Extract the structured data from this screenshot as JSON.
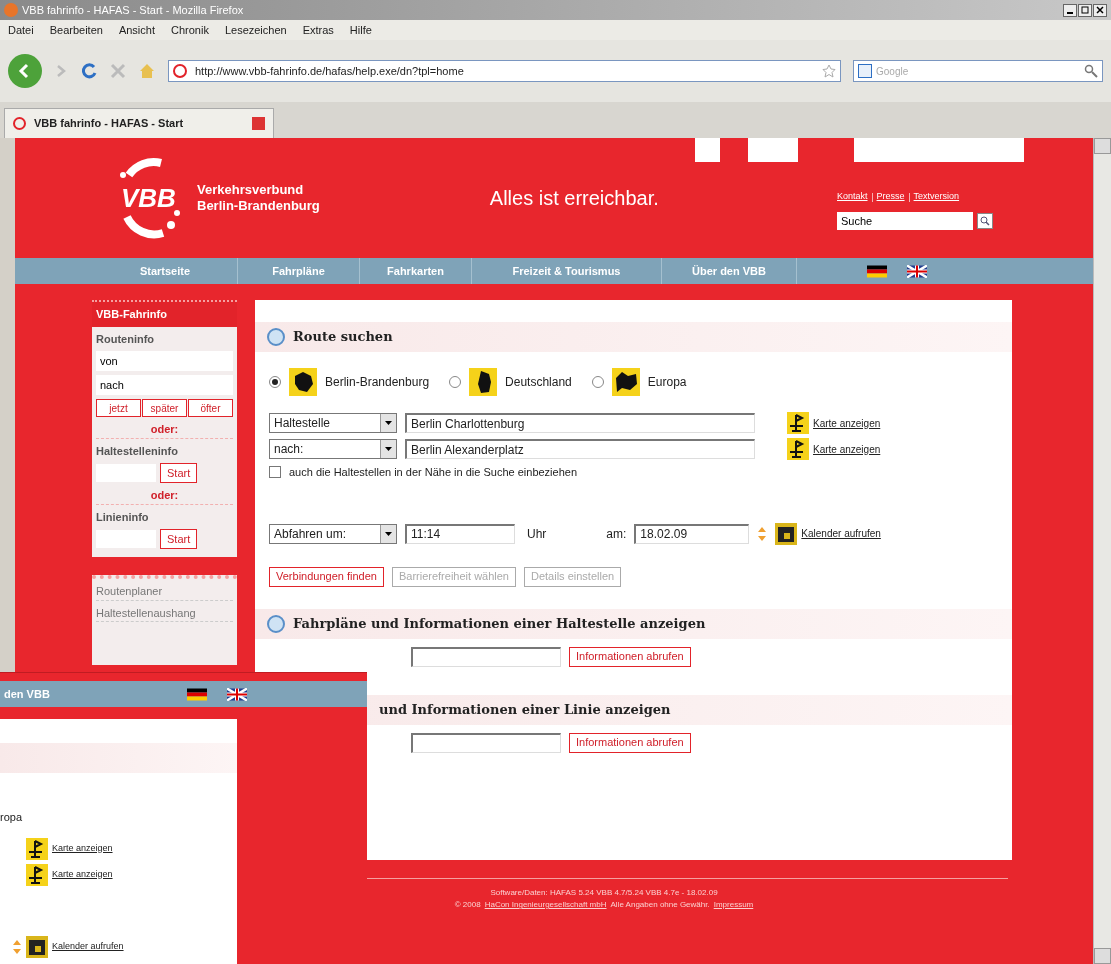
{
  "window": {
    "title": "VBB fahrinfo - HAFAS - Start - Mozilla Firefox"
  },
  "menu": [
    "Datei",
    "Bearbeiten",
    "Ansicht",
    "Chronik",
    "Lesezeichen",
    "Extras",
    "Hilfe"
  ],
  "address": "http://www.vbb-fahrinfo.de/hafas/help.exe/dn?tpl=home",
  "search_engine": {
    "placeholder": "Google"
  },
  "tab": {
    "label": "VBB fahrinfo - HAFAS - Start"
  },
  "header": {
    "logo": "VBB",
    "org_line1": "Verkehrsverbund",
    "org_line2": "Berlin-Brandenburg",
    "slogan": "Alles ist erreichbar.",
    "links": [
      "Kontakt",
      "Presse",
      "Textversion"
    ],
    "search": {
      "value": "Suche"
    }
  },
  "nav": [
    {
      "label": "Startseite"
    },
    {
      "label": "Fahrpläne"
    },
    {
      "label": "Fahrkarten"
    },
    {
      "label": "Freizeit & Tourismus"
    },
    {
      "label": "Über den VBB"
    }
  ],
  "sidebar": {
    "title": "VBB-Fahrinfo",
    "route_label": "Routeninfo",
    "from": "von",
    "to": "nach",
    "time_buttons": [
      "jetzt",
      "später",
      "öfter"
    ],
    "or1": "oder:",
    "stop_label": "Haltestelleninfo",
    "start1": "Start",
    "or2": "oder:",
    "line_label": "Linieninfo",
    "start2": "Start",
    "links": [
      "Routenplaner",
      "Haltestellenaushang"
    ]
  },
  "route": {
    "title": "Route suchen",
    "regions": [
      {
        "label": "Berlin-Brandenburg",
        "selected": true
      },
      {
        "label": "Deutschland",
        "selected": false
      },
      {
        "label": "Europa",
        "selected": false
      }
    ],
    "from_type": "Haltestelle",
    "from_value": "Berlin Charlottenburg",
    "to_type": "nach:",
    "to_value": "Berlin Alexanderplatz",
    "map_links": [
      "Karte anzeigen",
      "Karte anzeigen"
    ],
    "nearby": {
      "label": "auch die Haltestellen in der Nähe in die Suche einbeziehen",
      "checked": false
    },
    "time_mode": "Abfahren um:",
    "time": "11:14",
    "time_unit": "Uhr",
    "date_label": "am:",
    "date": "18.02.09",
    "calendar_link": "Kalender aufrufen",
    "buttons": [
      {
        "label": "Verbindungen finden",
        "disabled": false
      },
      {
        "label": "Barrierefreiheit wählen",
        "disabled": true
      },
      {
        "label": "Details einstellen",
        "disabled": true
      }
    ]
  },
  "stop_info": {
    "title": "Fahrpläne und Informationen einer Haltestelle anzeigen",
    "button": "Informationen abrufen"
  },
  "line_info": {
    "title": "und Informationen einer Linie anzeigen",
    "button": "Informationen abrufen"
  },
  "footer": {
    "line1": "Software/Daten: HAFAS 5.24 VBB 4.7/5.24 VBB 4.7e - 18.02.09",
    "copyright": "© 2008",
    "company_link": "HaCon Ingenieurgesellschaft mbH",
    "disclaimer": "Alle Angaben ohne Gewähr.",
    "imprint_link": "Impressum"
  },
  "inset": {
    "nav_fragment": "den VBB",
    "region_fragment": "ropa",
    "map_links": [
      "Karte anzeigen",
      "Karte anzeigen"
    ],
    "calendar_link": "Kalender aufrufen"
  }
}
